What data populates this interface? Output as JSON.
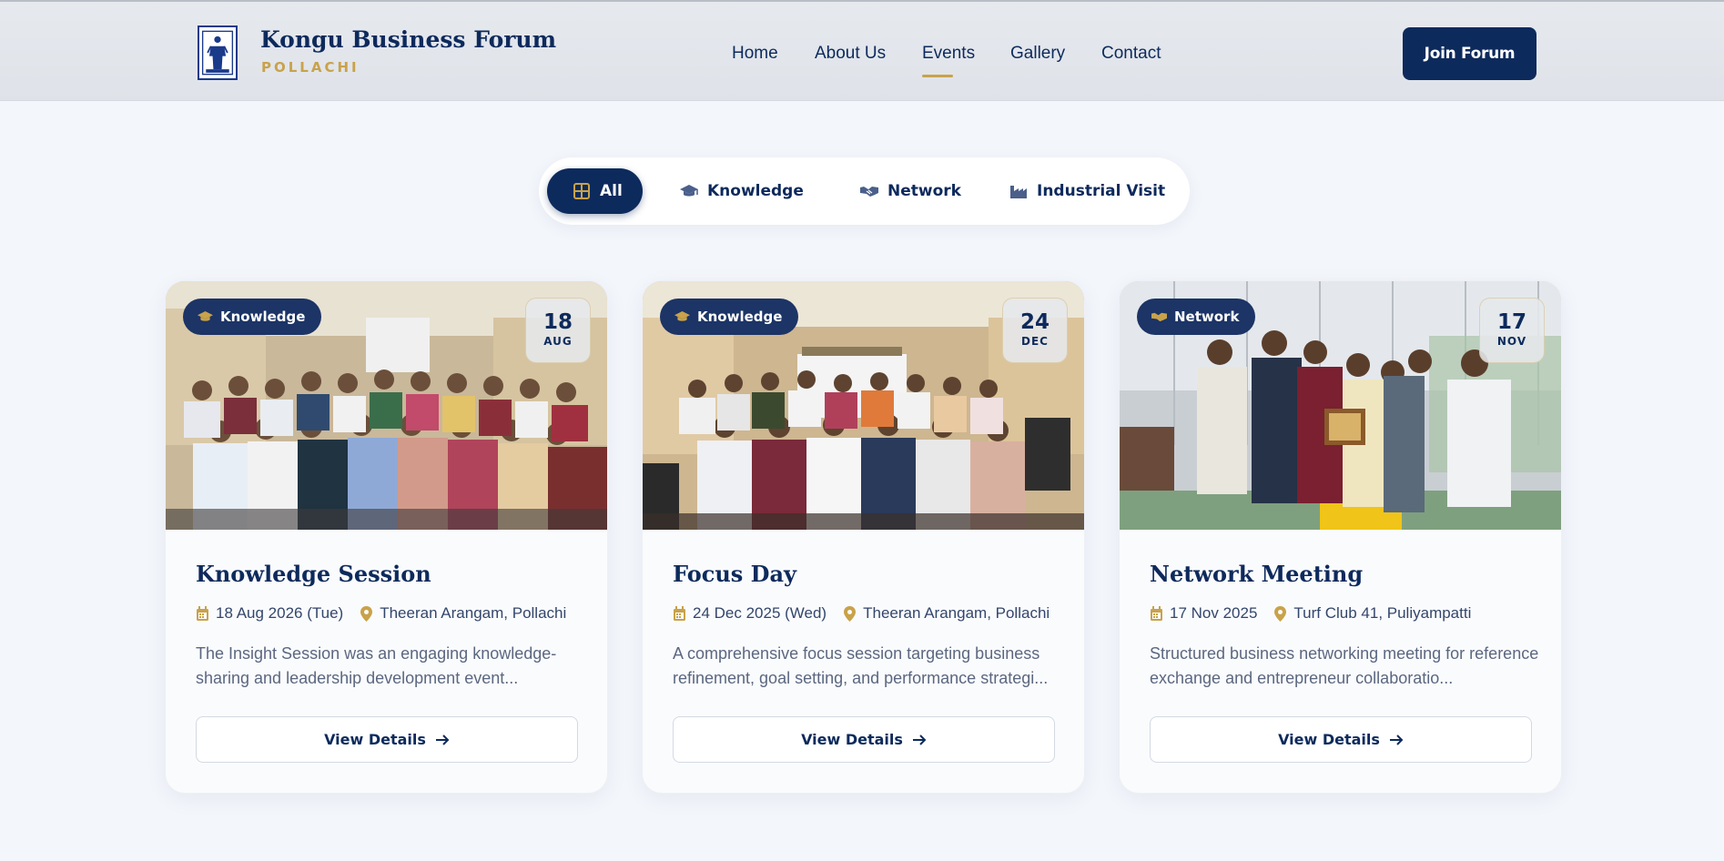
{
  "brand": {
    "title": "Kongu Business Forum",
    "subtitle": "POLLACHI"
  },
  "nav": {
    "items": [
      "Home",
      "About Us",
      "Events",
      "Gallery",
      "Contact"
    ],
    "active": "Events"
  },
  "header": {
    "join_label": "Join Forum"
  },
  "filters": {
    "items": [
      {
        "label": "All",
        "icon": "grid-icon",
        "active": true
      },
      {
        "label": "Knowledge",
        "icon": "graduation-cap-icon",
        "active": false
      },
      {
        "label": "Network",
        "icon": "handshake-icon",
        "active": false
      },
      {
        "label": "Industrial Visit",
        "icon": "industry-icon",
        "active": false
      }
    ]
  },
  "events": [
    {
      "category": "Knowledge",
      "category_icon": "graduation-cap-icon",
      "day": "18",
      "month": "AUG",
      "title": "Knowledge Session",
      "date": "18 Aug 2026 (Tue)",
      "location": "Theeran Arangam, Pollachi",
      "description": "The Insight Session was an engaging knowledge-sharing and leadership development event...",
      "cta": "View Details"
    },
    {
      "category": "Knowledge",
      "category_icon": "graduation-cap-icon",
      "day": "24",
      "month": "DEC",
      "title": "Focus Day",
      "date": "24 Dec 2025 (Wed)",
      "location": "Theeran Arangam, Pollachi",
      "description": "A comprehensive focus session targeting business refinement, goal setting, and performance strategi...",
      "cta": "View Details"
    },
    {
      "category": "Network",
      "category_icon": "handshake-icon",
      "day": "17",
      "month": "NOV",
      "title": "Network Meeting",
      "date": "17 Nov 2025",
      "location": "Turf Club 41, Puliyampatti",
      "description": "Structured business networking meeting for reference exchange and entrepreneur collaboratio...",
      "cta": "View Details"
    }
  ],
  "colors": {
    "navy": "#0d2a5c",
    "gold": "#c9a24a",
    "background": "#f3f6fb"
  }
}
